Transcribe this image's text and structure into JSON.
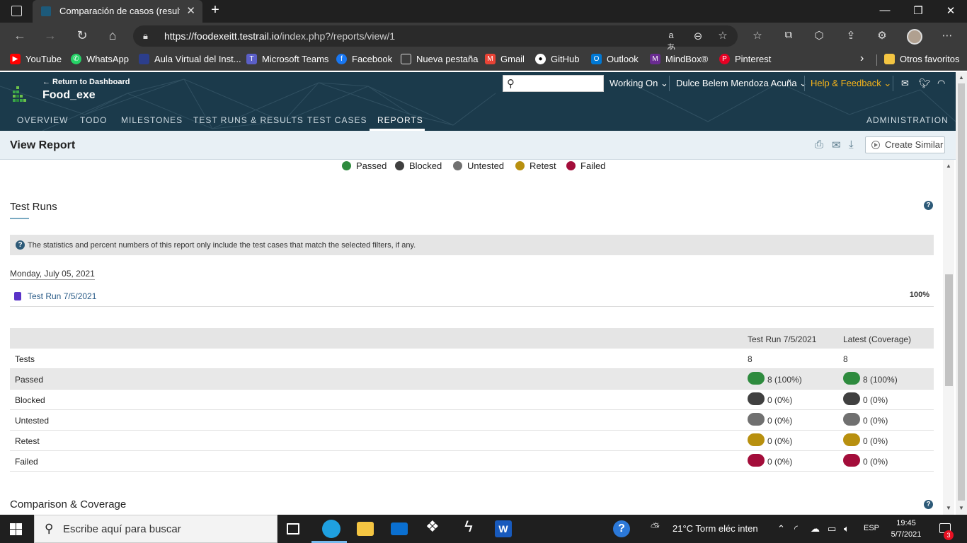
{
  "browser": {
    "tab_title": "Comparación de casos (resultado",
    "url_domain": "https://foodexeitt.testrail.io",
    "url_path": "/index.php?/reports/view/1"
  },
  "bookmarks": [
    {
      "label": "YouTube",
      "color": "#ff0000",
      "icon": "youtube-icon"
    },
    {
      "label": "WhatsApp",
      "color": "#25d366",
      "icon": "whatsapp-icon"
    },
    {
      "label": "Aula Virtual del Inst...",
      "color": "#2c3e8c",
      "icon": "aula-icon"
    },
    {
      "label": "Microsoft Teams",
      "color": "#5b5fc7",
      "icon": "teams-icon"
    },
    {
      "label": "Facebook",
      "color": "#1877f2",
      "icon": "facebook-icon"
    },
    {
      "label": "Nueva pestaña",
      "color": "#555555",
      "icon": "newtab-icon"
    },
    {
      "label": "Gmail",
      "color": "#ea4335",
      "icon": "gmail-icon"
    },
    {
      "label": "GitHub",
      "color": "#444444",
      "icon": "github-icon"
    },
    {
      "label": "Outlook",
      "color": "#0078d4",
      "icon": "outlook-icon"
    },
    {
      "label": "MindBox®",
      "color": "#6a2c91",
      "icon": "mindbox-icon"
    },
    {
      "label": "Pinterest",
      "color": "#e60023",
      "icon": "pinterest-icon"
    }
  ],
  "bookmarks_other": "Otros favoritos",
  "header": {
    "return_link": "← Return to Dashboard",
    "project": "Food_exe",
    "working_on": "Working On",
    "user": "Dulce Belem Mendoza Acuña",
    "help": "Help & Feedback"
  },
  "nav": {
    "items": [
      "OVERVIEW",
      "TODO",
      "MILESTONES",
      "TEST RUNS & RESULTS",
      "TEST CASES",
      "REPORTS"
    ],
    "active": "REPORTS",
    "admin": "ADMINISTRATION"
  },
  "report": {
    "title": "View Report",
    "create_similar": "Create Similar",
    "legend": [
      {
        "label": "Passed",
        "color": "#2e8b3e"
      },
      {
        "label": "Blocked",
        "color": "#404040"
      },
      {
        "label": "Untested",
        "color": "#707070"
      },
      {
        "label": "Retest",
        "color": "#b8900f"
      },
      {
        "label": "Failed",
        "color": "#a30d3a"
      }
    ],
    "section_title": "Test Runs",
    "info_text": "The statistics and percent numbers of this report only include the test cases that match the selected filters, if any.",
    "date": "Monday, July 05, 2021",
    "run_name": "Test Run 7/5/2021",
    "run_percent": "100%",
    "table": {
      "columns": [
        "Test Run 7/5/2021",
        "Latest (Coverage)"
      ],
      "rows": [
        {
          "label": "Tests",
          "values": [
            "8",
            "8"
          ],
          "color": ""
        },
        {
          "label": "Passed",
          "values": [
            "8 (100%)",
            "8 (100%)"
          ],
          "color": "#2e8b3e"
        },
        {
          "label": "Blocked",
          "values": [
            "0 (0%)",
            "0 (0%)"
          ],
          "color": "#404040"
        },
        {
          "label": "Untested",
          "values": [
            "0 (0%)",
            "0 (0%)"
          ],
          "color": "#707070"
        },
        {
          "label": "Retest",
          "values": [
            "0 (0%)",
            "0 (0%)"
          ],
          "color": "#b8900f"
        },
        {
          "label": "Failed",
          "values": [
            "0 (0%)",
            "0 (0%)"
          ],
          "color": "#a30d3a"
        }
      ]
    },
    "next_section": "Comparison & Coverage"
  },
  "taskbar": {
    "search_placeholder": "Escribe aquí para buscar",
    "weather": "21°C  Torm eléc inten",
    "lang": "ESP",
    "time": "19:45",
    "date": "5/7/2021",
    "notifications": "3"
  }
}
